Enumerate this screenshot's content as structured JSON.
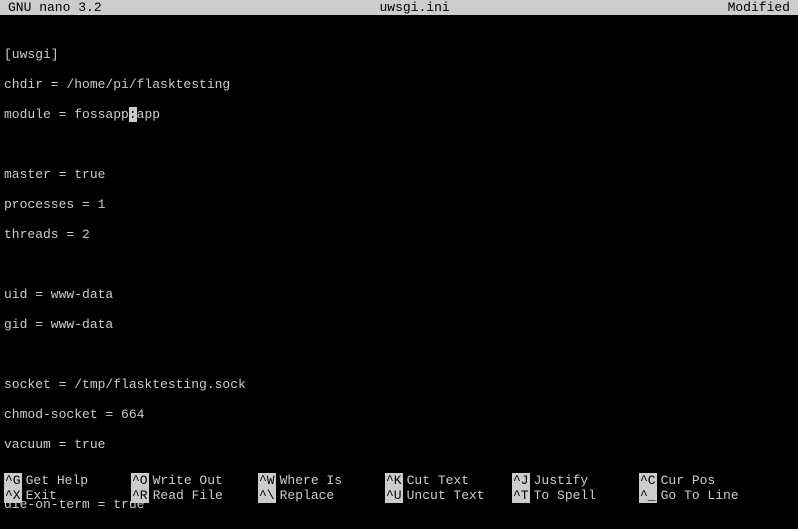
{
  "title": {
    "app": "GNU nano 3.2",
    "filename": "uwsgi.ini",
    "status": "Modified"
  },
  "content": {
    "line1": "[uwsgi]",
    "line2": "chdir = /home/pi/flasktesting",
    "line3a": "module = fossapp",
    "line3cursor": ":",
    "line3b": "app",
    "line4": "",
    "line5": "master = true",
    "line6": "processes = 1",
    "line7": "threads = 2",
    "line8": "",
    "line9": "uid = www-data",
    "line10": "gid = www-data",
    "line11": "",
    "line12": "socket = /tmp/flasktesting.sock",
    "line13": "chmod-socket = 664",
    "line14": "vacuum = true",
    "line15": "",
    "line16": "die-on-term = true"
  },
  "shortcuts": {
    "row1": [
      {
        "key": "^G",
        "label": "Get Help"
      },
      {
        "key": "^O",
        "label": "Write Out"
      },
      {
        "key": "^W",
        "label": "Where Is"
      },
      {
        "key": "^K",
        "label": "Cut Text"
      },
      {
        "key": "^J",
        "label": "Justify"
      },
      {
        "key": "^C",
        "label": "Cur Pos"
      }
    ],
    "row2": [
      {
        "key": "^X",
        "label": "Exit"
      },
      {
        "key": "^R",
        "label": "Read File"
      },
      {
        "key": "^\\",
        "label": "Replace"
      },
      {
        "key": "^U",
        "label": "Uncut Text"
      },
      {
        "key": "^T",
        "label": "To Spell"
      },
      {
        "key": "^_",
        "label": "Go To Line"
      }
    ]
  }
}
